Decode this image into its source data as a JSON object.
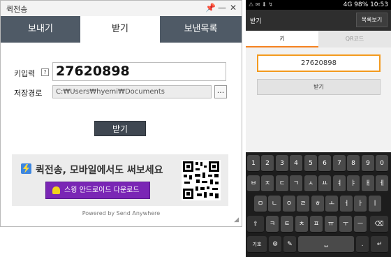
{
  "desktop": {
    "title": "퀵전송",
    "titlebar_buttons": {
      "pin": "📌",
      "minimize": "—",
      "close": "✕"
    },
    "tabs": [
      "보내기",
      "받기",
      "보낸목록"
    ],
    "active_tab_index": 1,
    "key_label": "키입력",
    "help_icon": "?",
    "key_value": "27620898",
    "save_path_label": "저장경로",
    "save_path_value": "C:₩Users₩hyemi₩Documents",
    "browse_label": "...",
    "receive_button": "받기",
    "banner": {
      "headline": "퀵전송, 모바일에서도 써보세요",
      "download_button": "스윙 안드로이드 다운로드"
    },
    "powered_by": "Powered by Send Anywhere",
    "colors": {
      "tab_dark": "#4f5a66",
      "receive_button": "#3f4751",
      "download_button": "#7a26b5",
      "bolt": "#3d86e0"
    }
  },
  "phone": {
    "status_time": "10:53",
    "status_signal": "4G",
    "status_battery": "98%",
    "action_bar_title": "받기",
    "sent_list_button": "목록보기",
    "tabs": [
      "키",
      "QR코드"
    ],
    "active_tab_index": 0,
    "key_value": "27620898",
    "receive_button": "받기",
    "colors": {
      "accent": "#f58220",
      "input_border": "#f39a1e"
    },
    "keyboard": {
      "row1": [
        "1",
        "2",
        "3",
        "4",
        "5",
        "6",
        "7",
        "8",
        "9",
        "0"
      ],
      "row2": [
        "ㅂ",
        "ㅈ",
        "ㄷ",
        "ㄱ",
        "ㅅ",
        "ㅛ",
        "ㅕ",
        "ㅑ",
        "ㅐ",
        "ㅔ"
      ],
      "row3": [
        "ㅁ",
        "ㄴ",
        "ㅇ",
        "ㄹ",
        "ㅎ",
        "ㅗ",
        "ㅓ",
        "ㅏ",
        "ㅣ"
      ],
      "row4": [
        "⇧",
        "ㅋ",
        "ㅌ",
        "ㅊ",
        "ㅍ",
        "ㅠ",
        "ㅜ",
        "ㅡ",
        "⌫"
      ],
      "row5": [
        "기호",
        "⚙",
        "✎",
        "␣",
        ".",
        "↵"
      ]
    }
  }
}
